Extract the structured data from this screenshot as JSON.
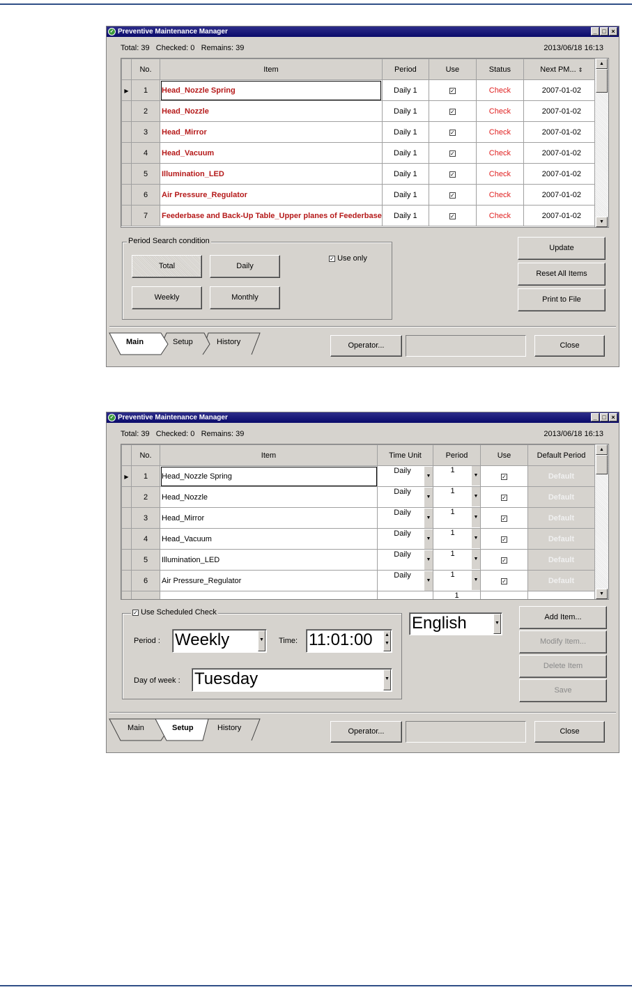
{
  "window_title": "Preventive Maintenance Manager",
  "window_controls": [
    "_",
    "□",
    "×"
  ],
  "summary": "Total: 39   Checked: 0   Remains: 39",
  "datetime": "2013/06/18 16:13",
  "main": {
    "columns": [
      "No.",
      "Item",
      "Period",
      "Use",
      "Status",
      "Next PM..."
    ],
    "rows": [
      {
        "no": "1",
        "item": "Head_Nozzle Spring",
        "period": "Daily 1",
        "status": "Check",
        "next": "2007-01-02"
      },
      {
        "no": "2",
        "item": "Head_Nozzle",
        "period": "Daily 1",
        "status": "Check",
        "next": "2007-01-02"
      },
      {
        "no": "3",
        "item": "Head_Mirror",
        "period": "Daily 1",
        "status": "Check",
        "next": "2007-01-02"
      },
      {
        "no": "4",
        "item": "Head_Vacuum",
        "period": "Daily 1",
        "status": "Check",
        "next": "2007-01-02"
      },
      {
        "no": "5",
        "item": "Illumination_LED",
        "period": "Daily 1",
        "status": "Check",
        "next": "2007-01-02"
      },
      {
        "no": "6",
        "item": "Air Pressure_Regulator",
        "period": "Daily 1",
        "status": "Check",
        "next": "2007-01-02"
      },
      {
        "no": "7",
        "item": "Feederbase and Back-Up Table_Upper planes of Feederbase",
        "period": "Daily 1",
        "status": "Check",
        "next": "2007-01-02"
      }
    ],
    "search_group": "Period Search condition",
    "use_only": "Use only",
    "filter_buttons": {
      "total": "Total",
      "daily": "Daily",
      "weekly": "Weekly",
      "monthly": "Monthly"
    },
    "actions": {
      "update": "Update",
      "reset": "Reset All Items",
      "print": "Print to File"
    }
  },
  "setup": {
    "columns": [
      "No.",
      "Item",
      "Time Unit",
      "Period",
      "Use",
      "Default Period"
    ],
    "rows": [
      {
        "no": "1",
        "item": "Head_Nozzle Spring",
        "unit": "Daily",
        "period": "1",
        "def": "Default"
      },
      {
        "no": "2",
        "item": "Head_Nozzle",
        "unit": "Daily",
        "period": "1",
        "def": "Default"
      },
      {
        "no": "3",
        "item": "Head_Mirror",
        "unit": "Daily",
        "period": "1",
        "def": "Default"
      },
      {
        "no": "4",
        "item": "Head_Vacuum",
        "unit": "Daily",
        "period": "1",
        "def": "Default"
      },
      {
        "no": "5",
        "item": "Illumination_LED",
        "unit": "Daily",
        "period": "1",
        "def": "Default"
      },
      {
        "no": "6",
        "item": "Air Pressure_Regulator",
        "unit": "Daily",
        "period": "1",
        "def": "Default"
      }
    ],
    "partial_row_period": "1",
    "scheduled_group": "Use Scheduled Check",
    "period_label": "Period :",
    "period_value": "Weekly",
    "time_label": "Time:",
    "time_value": "11:01:00",
    "dow_label": "Day of week :",
    "dow_value": "Tuesday",
    "language": "English",
    "actions": {
      "add": "Add Item...",
      "modify": "Modify Item...",
      "delete": "Delete Item",
      "save": "Save"
    }
  },
  "tabs": [
    "Main",
    "Setup",
    "History"
  ],
  "operator_button": "Operator...",
  "close_button": "Close",
  "colors": {
    "title_bar": "#0a0a6a",
    "face": "#d6d3ce",
    "red_item": "#b51a1a",
    "status_red": "#e02020"
  }
}
